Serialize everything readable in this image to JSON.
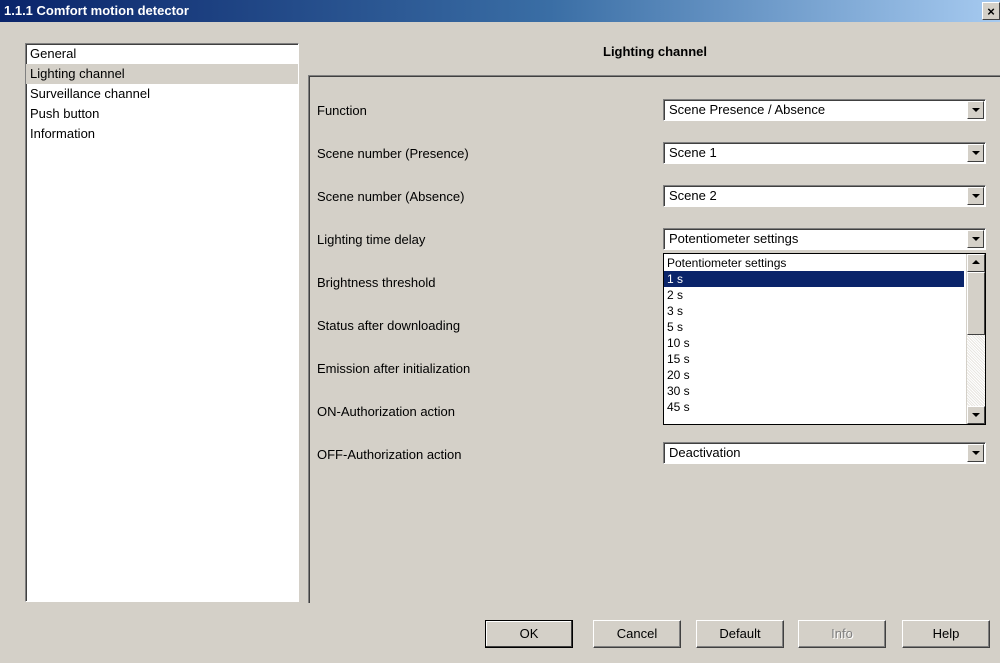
{
  "window": {
    "title": "1.1.1 Comfort motion detector",
    "close_label": "×"
  },
  "nav": {
    "items": [
      {
        "label": "General"
      },
      {
        "label": "Lighting channel"
      },
      {
        "label": "Surveillance channel"
      },
      {
        "label": "Push button"
      },
      {
        "label": "Information"
      }
    ],
    "selected_index": 1
  },
  "section": {
    "title": "Lighting channel"
  },
  "params": [
    {
      "label": "Function",
      "value": "Scene Presence / Absence"
    },
    {
      "label": "Scene number (Presence)",
      "value": "Scene 1"
    },
    {
      "label": "Scene number (Absence)",
      "value": "Scene 2"
    },
    {
      "label": "Lighting time delay",
      "value": "Potentiometer settings"
    },
    {
      "label": "Brightness threshold"
    },
    {
      "label": "Status after downloading"
    },
    {
      "label": "Emission after initialization"
    },
    {
      "label": "ON-Authorization action"
    },
    {
      "label": "OFF-Authorization action",
      "value": "Deactivation"
    }
  ],
  "dropdown": {
    "options": [
      "Potentiometer settings",
      "1 s",
      "2 s",
      "3 s",
      "5 s",
      "10 s",
      "15 s",
      "20 s",
      "30 s",
      "45 s"
    ],
    "highlighted": "1 s"
  },
  "buttons": {
    "ok": "OK",
    "cancel": "Cancel",
    "default": "Default",
    "info": "Info",
    "help": "Help"
  },
  "colors": {
    "titlebar": "#0a246a",
    "selection": "#0a246a",
    "face": "#d4d0c8"
  }
}
